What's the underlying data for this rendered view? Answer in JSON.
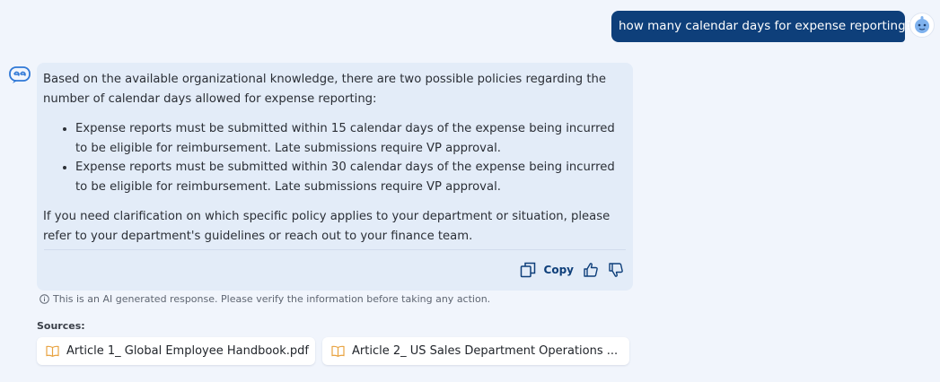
{
  "user_message": {
    "text": "how many calendar days for expense reporting?",
    "avatar_icon": "robot-avatar-icon"
  },
  "assistant": {
    "avatar_icon": "bot-logo-icon",
    "intro": "Based on the available organizational knowledge, there are two possible policies regarding the number of calendar days allowed for expense reporting:",
    "bullets": [
      "Expense reports must be submitted within 15 calendar days of the expense being incurred to be eligible for reimbursement. Late submissions require VP approval.",
      "Expense reports must be submitted within 30 calendar days of the expense being incurred to be eligible for reimbursement. Late submissions require VP approval."
    ],
    "outro": "If you need clarification on which specific policy applies to your department or situation, please refer to your department's guidelines or reach out to your finance team.",
    "actions": {
      "copy_label": "Copy",
      "copy_icon": "copy-icon",
      "like_icon": "thumbs-up-icon",
      "dislike_icon": "thumbs-down-icon"
    }
  },
  "disclaimer": "This is an AI generated response. Please verify the information before taking any action.",
  "sources": {
    "label": "Sources:",
    "items": [
      {
        "title": "Article 1_ Global Employee Handbook.pdf",
        "icon": "book-icon"
      },
      {
        "title": "Article 2_ US Sales Department Operations ...",
        "icon": "book-icon"
      }
    ]
  },
  "colors": {
    "background": "#f1f5fc",
    "user_bubble": "#0e3f7a",
    "answer_card": "#e3ecf8",
    "accent": "#0e3f7a",
    "source_icon": "#e8a341"
  }
}
